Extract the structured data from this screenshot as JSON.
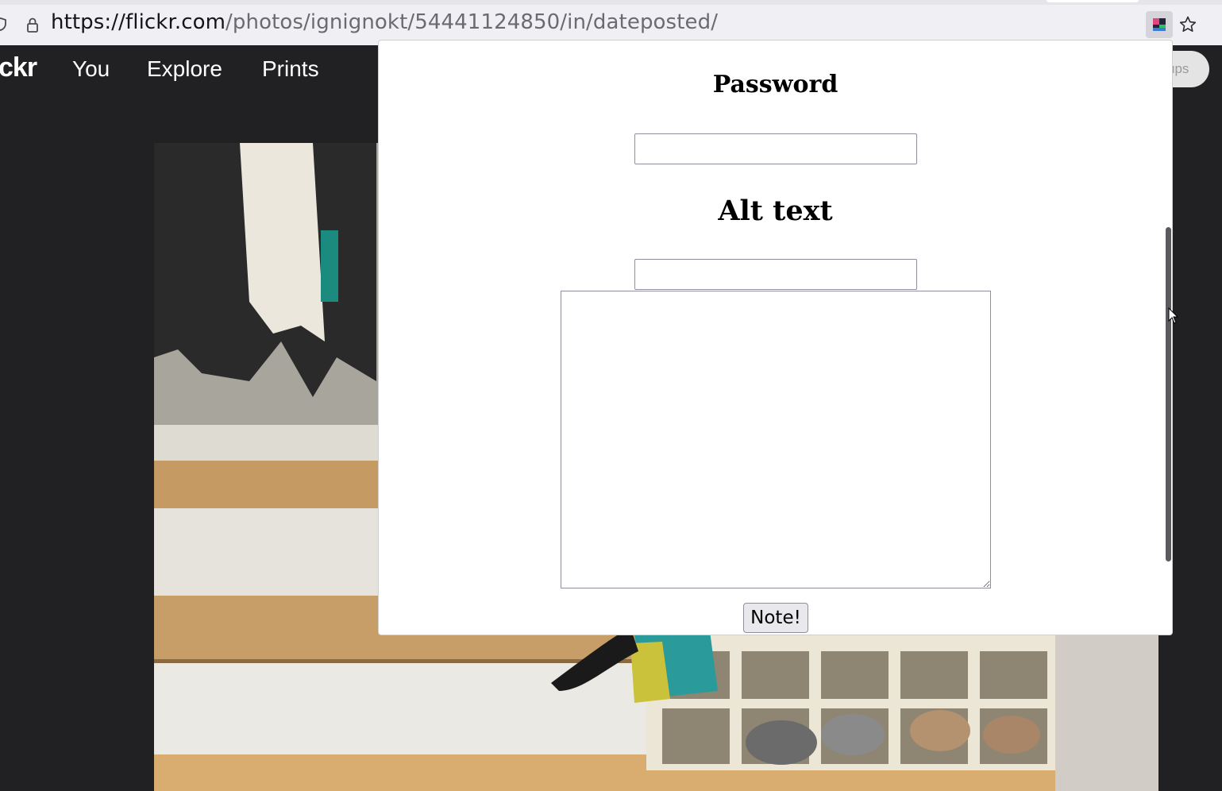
{
  "browser": {
    "url_domain": "https://flickr.com",
    "url_path": "/photos/ignignokt/54441124850/in/dateposted/",
    "icons": [
      "shield-icon",
      "lock-icon",
      "extension-icon",
      "bookmark-star-icon"
    ]
  },
  "nav": {
    "logo": "ckr",
    "links": [
      "You",
      "Explore",
      "Prints"
    ],
    "pill_text": "ups"
  },
  "modal": {
    "password_heading": "Password",
    "password_value": "",
    "alt_heading": "Alt text",
    "alt_value": "",
    "note_value": "",
    "submit_label": "Note!"
  },
  "colors": {
    "page_bg": "#212124",
    "modal_bg": "#ffffff",
    "urlbar_bg": "#f0f0f4"
  }
}
